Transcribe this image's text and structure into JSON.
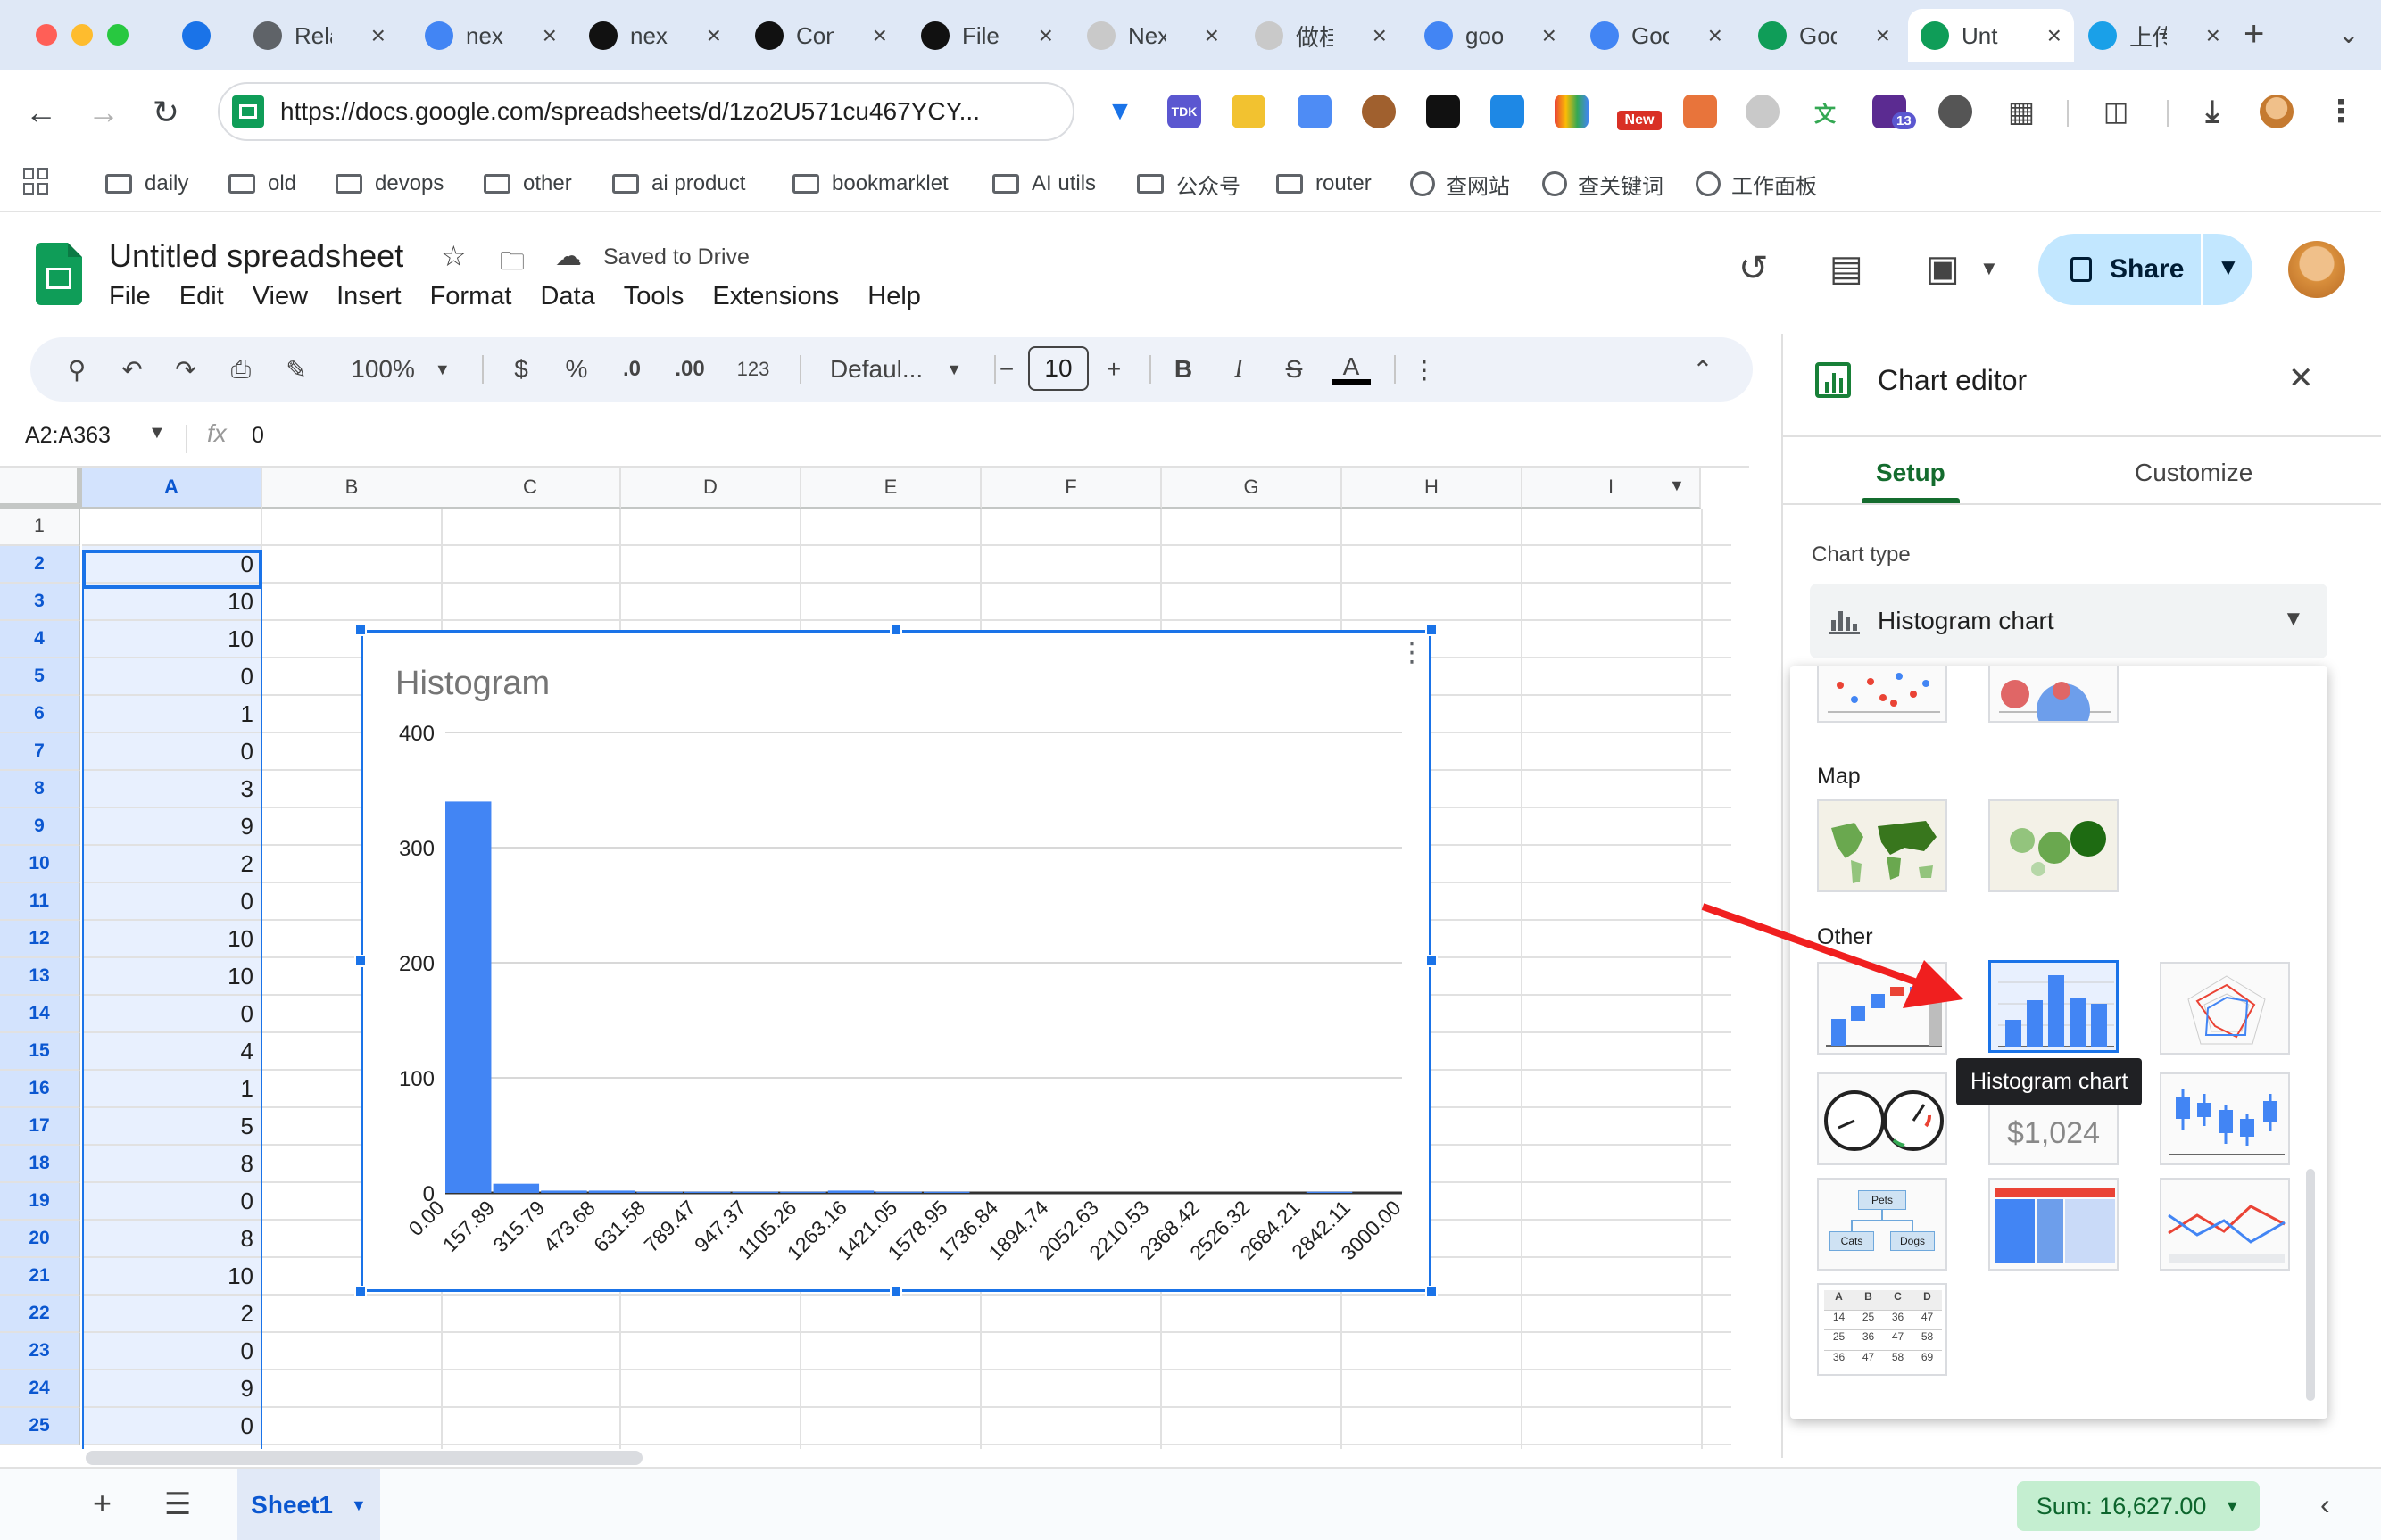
{
  "browser": {
    "tabs": [
      {
        "label": "",
        "icon": "vee-logo-icon",
        "color": "#1a73e8"
      },
      {
        "label": "Rela",
        "icon": "openai-logo-icon",
        "color": "#5f6368"
      },
      {
        "label": "next",
        "icon": "google-g-icon",
        "color": "#4285f4"
      },
      {
        "label": "next",
        "icon": "notion-logo-icon",
        "color": "#111111"
      },
      {
        "label": "Con",
        "icon": "notion-logo-icon",
        "color": "#111111"
      },
      {
        "label": "File",
        "icon": "notion-logo-icon",
        "color": "#111111"
      },
      {
        "label": "Nex",
        "icon": "openai-logo-icon",
        "color": "#c9c9c9"
      },
      {
        "label": "做桂",
        "icon": "openai-logo-icon",
        "color": "#c9c9c9"
      },
      {
        "label": "goo",
        "icon": "google-g-icon",
        "color": "#4285f4"
      },
      {
        "label": "Goo",
        "icon": "google-g-icon",
        "color": "#4285f4"
      },
      {
        "label": "Goo",
        "icon": "sheets-icon",
        "color": "#0f9d58"
      },
      {
        "label": "Unt",
        "icon": "sheets-icon",
        "color": "#0f9d58"
      },
      {
        "label": "上传",
        "icon": "upload-logo-icon",
        "color": "#1aa0e8"
      }
    ],
    "url": "https://docs.google.com/spreadsheets/d/1zo2U571cu467YCY...",
    "ext_new_badge": "New",
    "ext_count_badge": "13",
    "bookmarks": [
      {
        "label": "daily",
        "icon": "folder-icon"
      },
      {
        "label": "old",
        "icon": "folder-icon"
      },
      {
        "label": "devops",
        "icon": "folder-icon"
      },
      {
        "label": "other",
        "icon": "folder-icon"
      },
      {
        "label": "ai product",
        "icon": "folder-icon"
      },
      {
        "label": "bookmarklet",
        "icon": "folder-icon"
      },
      {
        "label": "AI utils",
        "icon": "folder-icon"
      },
      {
        "label": "公众号",
        "icon": "folder-icon"
      },
      {
        "label": "router",
        "icon": "folder-icon"
      },
      {
        "label": "查网站",
        "icon": "globe-icon"
      },
      {
        "label": "查关键词",
        "icon": "globe-icon"
      },
      {
        "label": "工作面板",
        "icon": "globe-icon"
      }
    ]
  },
  "sheets": {
    "title": "Untitled spreadsheet",
    "saved_status": "Saved to Drive",
    "menu": [
      "File",
      "Edit",
      "View",
      "Insert",
      "Format",
      "Data",
      "Tools",
      "Extensions",
      "Help"
    ],
    "share_label": "Share",
    "toolbar": {
      "zoom": "100%",
      "currency": "$",
      "percent": "%",
      "dec_decrease": ".0",
      "dec_increase": ".00",
      "number_format": "123",
      "font": "Defaul...",
      "font_size": "10",
      "bold": "B",
      "italic": "I",
      "strike": "S",
      "text_color": "A"
    },
    "name_box": "A2:A363",
    "formula_value": "0",
    "columns": [
      "A",
      "B",
      "C",
      "D",
      "E",
      "F",
      "G",
      "H",
      "I"
    ],
    "rows": [
      {
        "num": "1",
        "a": ""
      },
      {
        "num": "2",
        "a": "0"
      },
      {
        "num": "3",
        "a": "10"
      },
      {
        "num": "4",
        "a": "10"
      },
      {
        "num": "5",
        "a": "0"
      },
      {
        "num": "6",
        "a": "1"
      },
      {
        "num": "7",
        "a": "0"
      },
      {
        "num": "8",
        "a": "3"
      },
      {
        "num": "9",
        "a": "9"
      },
      {
        "num": "10",
        "a": "2"
      },
      {
        "num": "11",
        "a": "0"
      },
      {
        "num": "12",
        "a": "10"
      },
      {
        "num": "13",
        "a": "10"
      },
      {
        "num": "14",
        "a": "0"
      },
      {
        "num": "15",
        "a": "4"
      },
      {
        "num": "16",
        "a": "1"
      },
      {
        "num": "17",
        "a": "5"
      },
      {
        "num": "18",
        "a": "8"
      },
      {
        "num": "19",
        "a": "0"
      },
      {
        "num": "20",
        "a": "8"
      },
      {
        "num": "21",
        "a": "10"
      },
      {
        "num": "22",
        "a": "2"
      },
      {
        "num": "23",
        "a": "0"
      },
      {
        "num": "24",
        "a": "9"
      },
      {
        "num": "25",
        "a": "0"
      }
    ],
    "sheet_tab": "Sheet1",
    "sum": "Sum: 16,627.00"
  },
  "chart_editor": {
    "title": "Chart editor",
    "tabs": [
      "Setup",
      "Customize"
    ],
    "chart_type_label": "Chart type",
    "chart_type_value": "Histogram chart",
    "section_map": "Map",
    "section_other": "Other",
    "tooltip": "Histogram chart",
    "scorecard_value": "$1,024",
    "org_labels": [
      "Pets",
      "Cats",
      "Dogs"
    ],
    "table_thumb": [
      [
        "A",
        "B",
        "C",
        "D"
      ],
      [
        "14",
        "25",
        "36",
        "47"
      ],
      [
        "25",
        "36",
        "47",
        "58"
      ],
      [
        "36",
        "47",
        "58",
        "69"
      ]
    ]
  },
  "chart_data": {
    "type": "bar",
    "title": "Histogram",
    "bar_color": "#4285f4",
    "ylim": [
      0,
      400
    ],
    "yticks": [
      0,
      100,
      200,
      300,
      400
    ],
    "categories": [
      "0.00",
      "157.89",
      "315.79",
      "473.68",
      "631.58",
      "789.47",
      "947.37",
      "1105.26",
      "1263.16",
      "1421.05",
      "1578.95",
      "1736.84",
      "1894.74",
      "2052.63",
      "2210.53",
      "2368.42",
      "2526.32",
      "2684.21",
      "2842.11",
      "3000.00"
    ],
    "values": [
      340,
      8,
      2,
      2,
      1,
      1,
      1,
      1,
      2,
      1,
      1,
      0,
      0,
      0,
      0,
      0,
      0,
      0,
      1,
      0
    ],
    "grid": true
  }
}
